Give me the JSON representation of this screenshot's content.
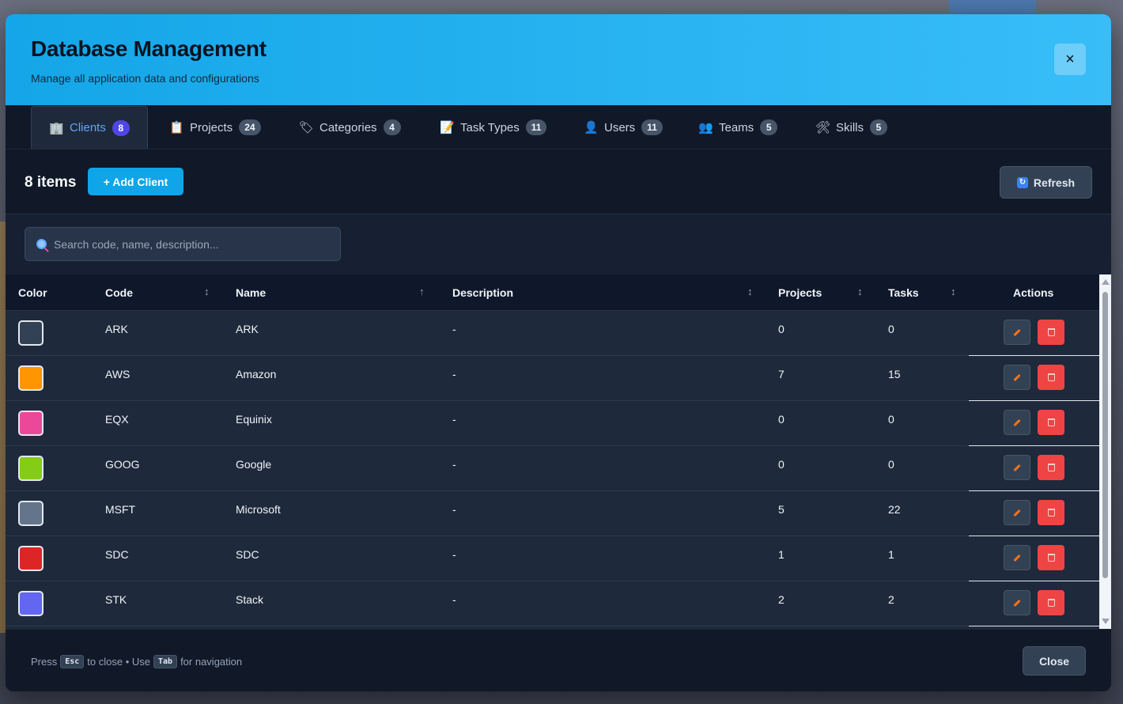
{
  "modal": {
    "title": "Database Management",
    "subtitle": "Manage all application data and configurations",
    "close_icon": "×"
  },
  "tabs": [
    {
      "label": "Clients",
      "count": "8",
      "icon": "🏢",
      "active": true
    },
    {
      "label": "Projects",
      "count": "24",
      "icon": "📋"
    },
    {
      "label": "Categories",
      "count": "4",
      "icon": "🏷"
    },
    {
      "label": "Task Types",
      "count": "11",
      "icon": "📝"
    },
    {
      "label": "Users",
      "count": "11",
      "icon": "👤"
    },
    {
      "label": "Teams",
      "count": "5",
      "icon": "👥"
    },
    {
      "label": "Skills",
      "count": "5",
      "icon": "🛠"
    }
  ],
  "toolbar": {
    "items_count": "8 items",
    "add_label": "+ Add Client",
    "refresh_label": "Refresh",
    "refresh_icon": "↻"
  },
  "search": {
    "placeholder": "Search code, name, description..."
  },
  "table": {
    "headers": {
      "color": "Color",
      "code": "Code",
      "name": "Name",
      "description": "Description",
      "projects": "Projects",
      "tasks": "Tasks",
      "actions": "Actions"
    },
    "sort_icons": {
      "code": "↕",
      "name": "↑",
      "description": "↕",
      "projects": "↕",
      "tasks": "↕"
    },
    "rows": [
      {
        "color": "#334155",
        "code": "ARK",
        "name": "ARK",
        "description": "-",
        "projects": "0",
        "tasks": "0"
      },
      {
        "color": "#ff9500",
        "code": "AWS",
        "name": "Amazon",
        "description": "-",
        "projects": "7",
        "tasks": "15"
      },
      {
        "color": "#ec4899",
        "code": "EQX",
        "name": "Equinix",
        "description": "-",
        "projects": "0",
        "tasks": "0"
      },
      {
        "color": "#84cc16",
        "code": "GOOG",
        "name": "Google",
        "description": "-",
        "projects": "0",
        "tasks": "0"
      },
      {
        "color": "#64748b",
        "code": "MSFT",
        "name": "Microsoft",
        "description": "-",
        "projects": "5",
        "tasks": "22"
      },
      {
        "color": "#dc2626",
        "code": "SDC",
        "name": "SDC",
        "description": "-",
        "projects": "1",
        "tasks": "1"
      },
      {
        "color": "#6366f1",
        "code": "STK",
        "name": "Stack",
        "description": "-",
        "projects": "2",
        "tasks": "2"
      }
    ]
  },
  "footer": {
    "press": "Press",
    "esc_key": "Esc",
    "to_close": "to close • Use",
    "tab_key": "Tab",
    "for_navigation": "for navigation",
    "close_label": "Close"
  }
}
